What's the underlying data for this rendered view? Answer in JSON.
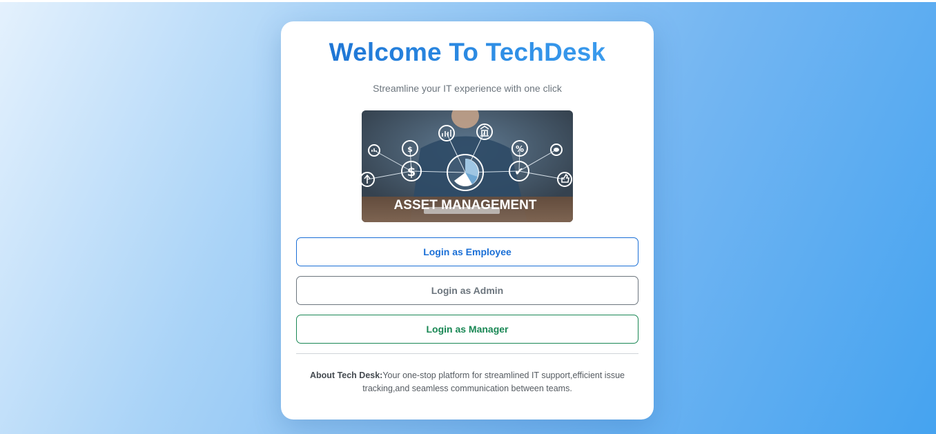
{
  "card": {
    "title": "Welcome To TechDesk",
    "subtitle": "Streamline your IT experience with one click"
  },
  "hero": {
    "caption": "ASSET MANAGEMENT",
    "icons": [
      "pie-chart-icon",
      "dollar-icon",
      "money-bag-icon",
      "bar-chart-icon",
      "bank-icon",
      "percent-icon",
      "check-icon",
      "thumbs-up-icon",
      "arrow-up-icon",
      "chart-icon",
      "piggy-bank-icon"
    ]
  },
  "buttons": {
    "employee": "Login as Employee",
    "admin": "Login as Admin",
    "manager": "Login as Manager"
  },
  "about": {
    "label": "About Tech Desk:",
    "text": "Your one-stop platform for streamlined IT support,efficient issue tracking,and seamless communication between teams."
  },
  "colors": {
    "title_blue": "#1e7ad8",
    "employee": "#1a6fd6",
    "admin": "#6c757d",
    "manager": "#198754"
  }
}
